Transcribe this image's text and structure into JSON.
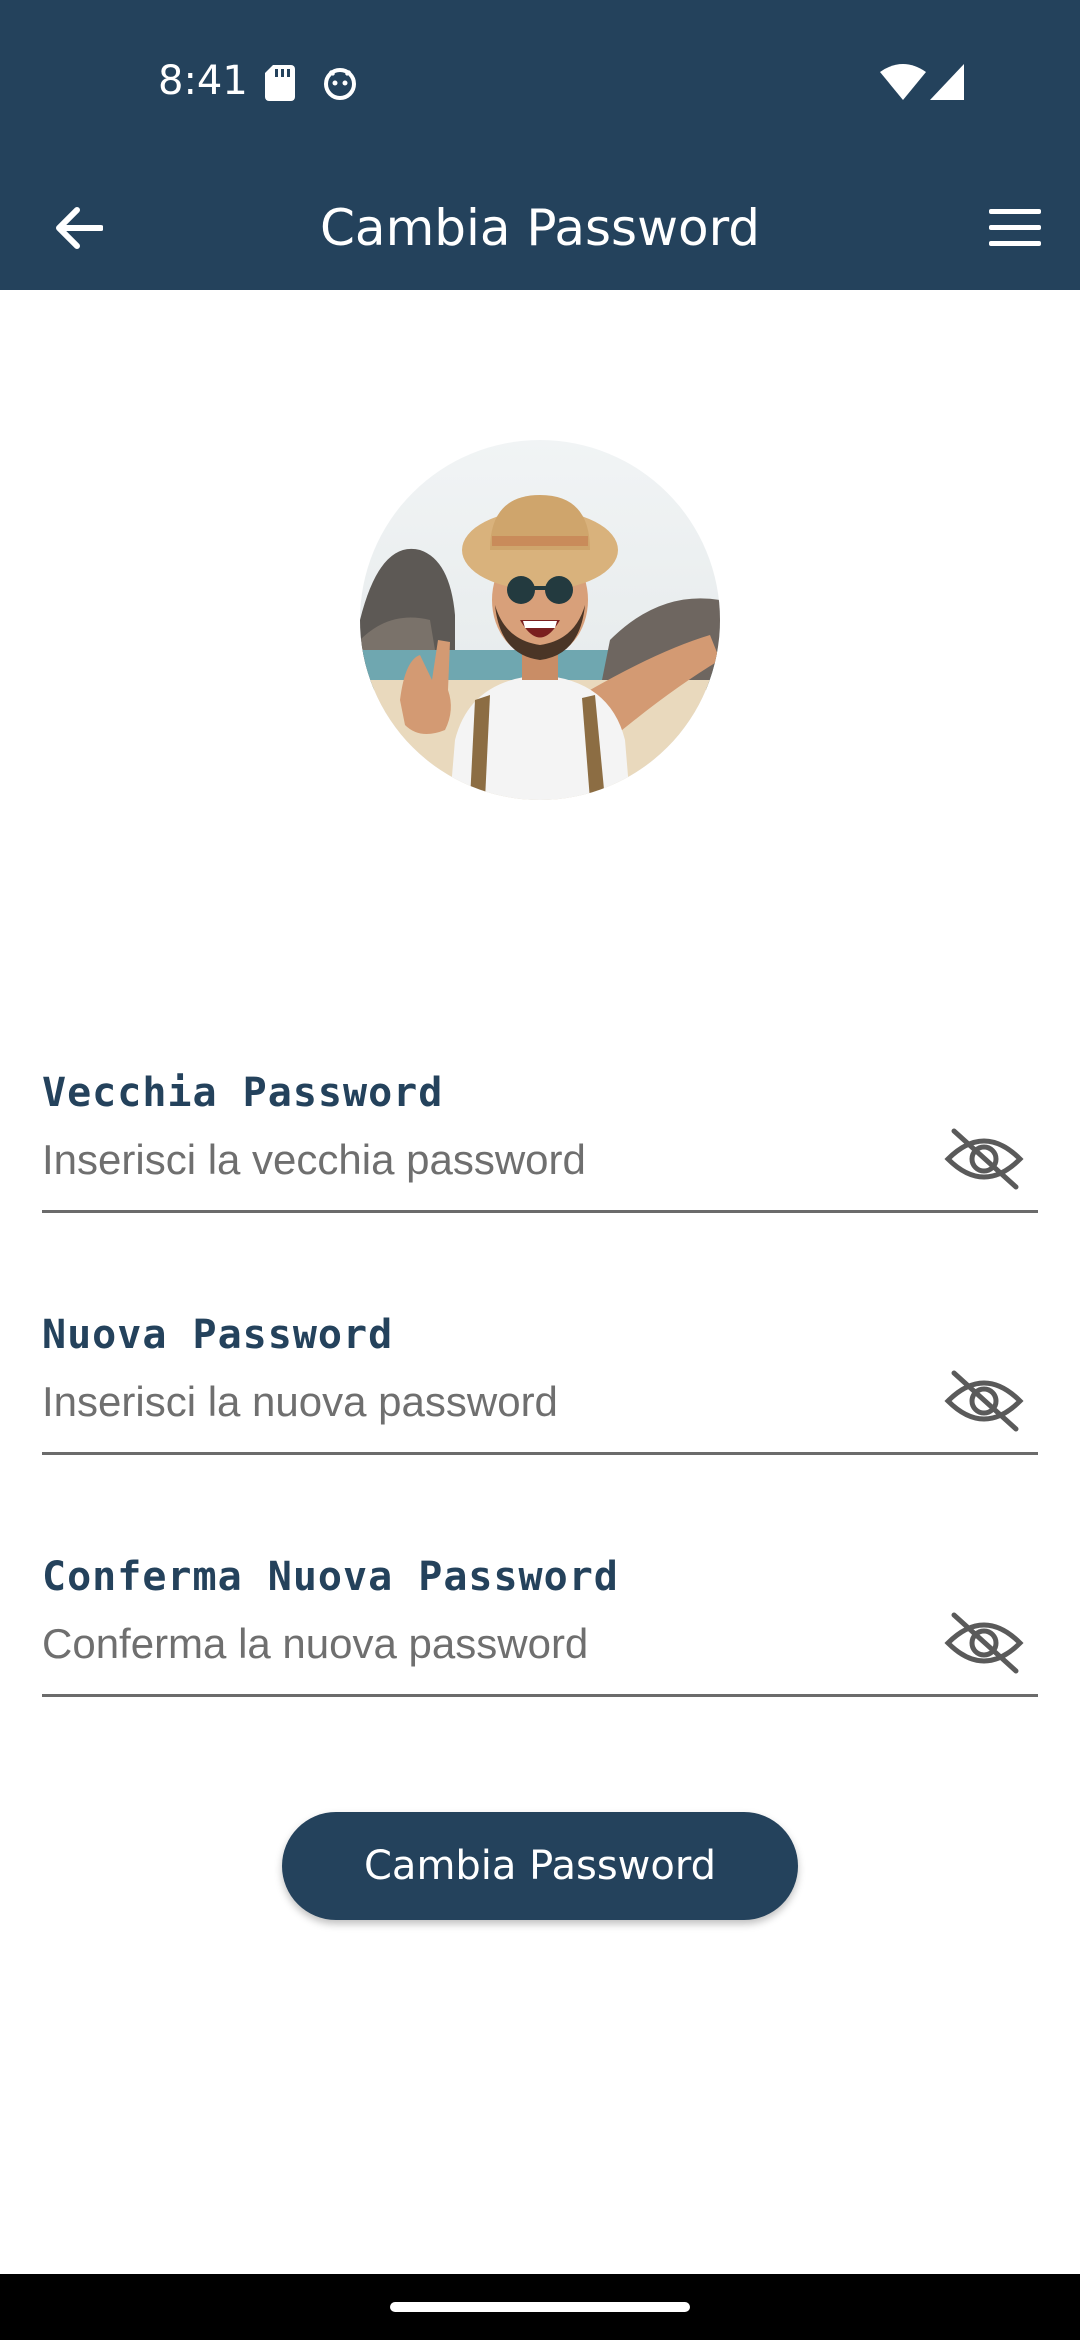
{
  "status_bar": {
    "time": "8:41",
    "icons": [
      "sd-card-icon",
      "face-icon",
      "wifi-icon",
      "signal-icon"
    ]
  },
  "app_bar": {
    "title": "Cambia Password",
    "back_icon": "arrow-left-icon",
    "menu_icon": "hamburger-menu-icon"
  },
  "avatar": {
    "icon": "profile-photo"
  },
  "form": {
    "fields": [
      {
        "label": "Vecchia Password",
        "placeholder": "Inserisci la vecchia password",
        "value": "",
        "toggle_icon": "eye-off-icon"
      },
      {
        "label": "Nuova Password",
        "placeholder": "Inserisci la nuova password",
        "value": "",
        "toggle_icon": "eye-off-icon"
      },
      {
        "label": "Conferma Nuova Password",
        "placeholder": "Conferma la nuova password",
        "value": "",
        "toggle_icon": "eye-off-icon"
      }
    ],
    "submit_label": "Cambia Password"
  },
  "colors": {
    "primary": "#24425c",
    "background": "#ffffff",
    "placeholder": "#6f6f6f",
    "underline": "#6b6b6b"
  }
}
